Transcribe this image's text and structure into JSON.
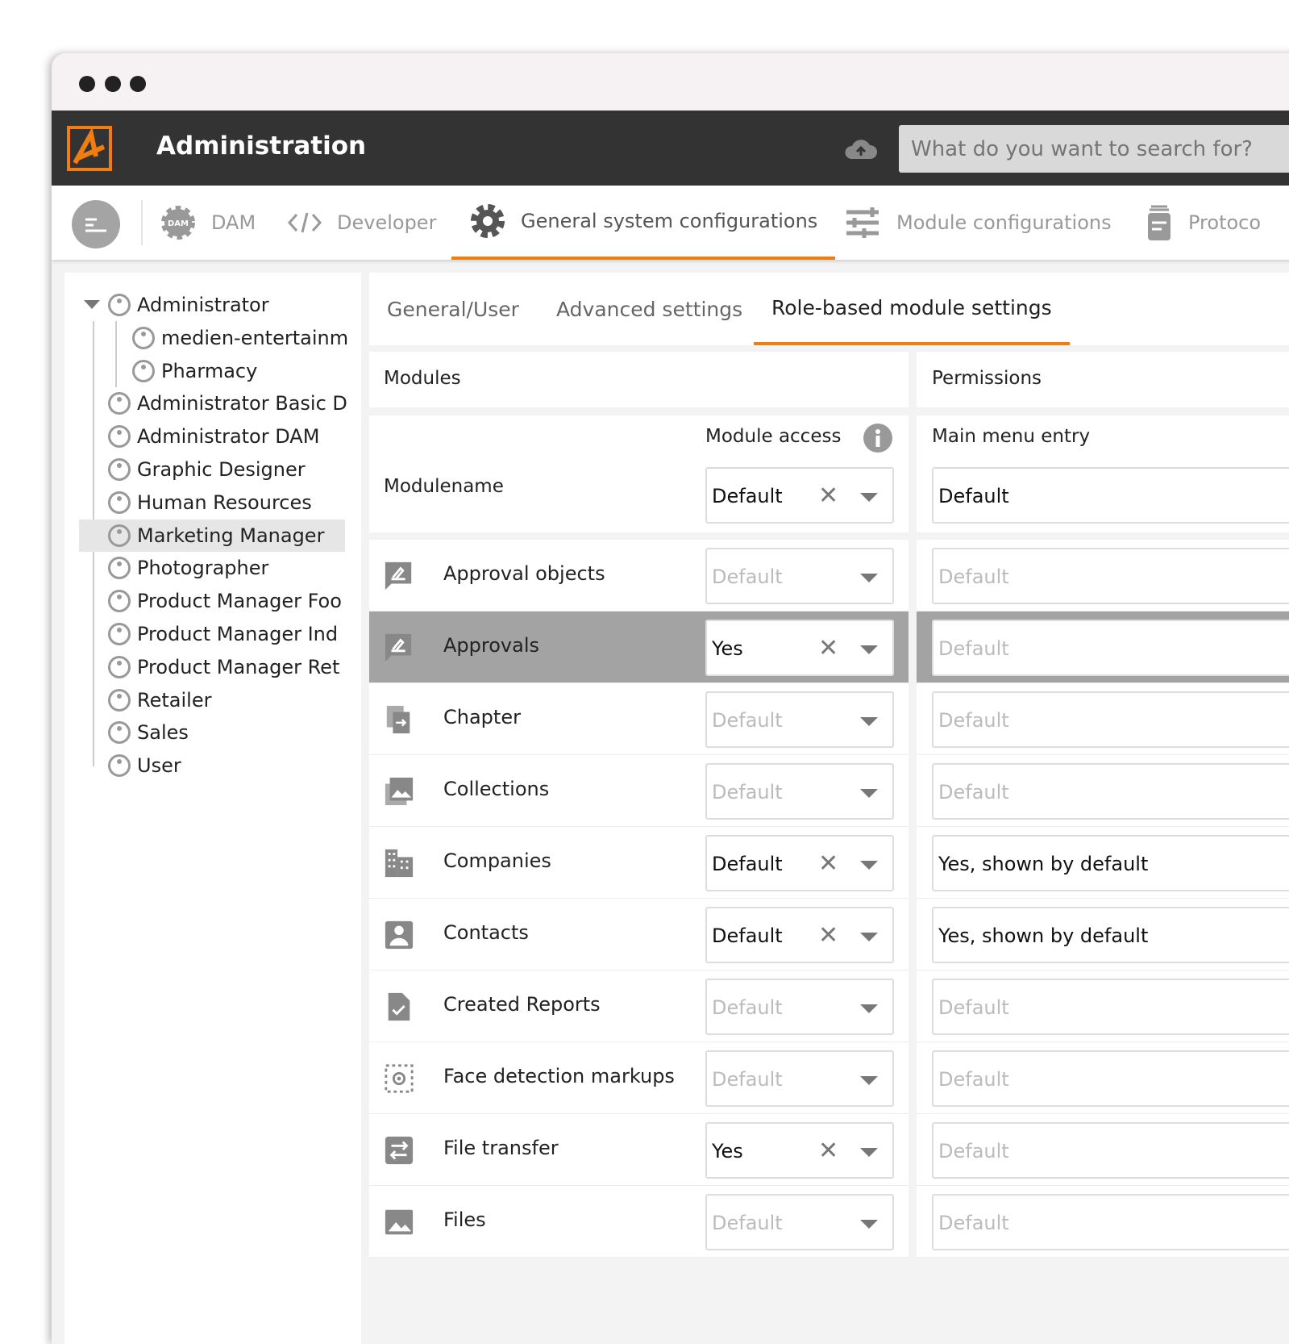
{
  "window": {
    "dots": 3
  },
  "header": {
    "title": "Administration",
    "search_placeholder": "What do you want to search for?"
  },
  "nav": {
    "tabs": [
      {
        "label": "DAM",
        "icon": "dam-gear-icon"
      },
      {
        "label": "Developer",
        "icon": "code-icon"
      },
      {
        "label": "General system configurations",
        "icon": "gear-icon",
        "active": true
      },
      {
        "label": "Module configurations",
        "icon": "sliders-icon"
      },
      {
        "label": "Protoco",
        "icon": "protocol-icon"
      }
    ]
  },
  "sidebar": {
    "roles": [
      {
        "label": "Administrator",
        "level": 0,
        "expanded": true
      },
      {
        "label": "medien-entertainm",
        "level": 1
      },
      {
        "label": "Pharmacy",
        "level": 1
      },
      {
        "label": "Administrator Basic D",
        "level": 0
      },
      {
        "label": "Administrator DAM",
        "level": 0
      },
      {
        "label": "Graphic Designer",
        "level": 0
      },
      {
        "label": "Human Resources",
        "level": 0
      },
      {
        "label": "Marketing Manager",
        "level": 0,
        "selected": true
      },
      {
        "label": "Photographer",
        "level": 0
      },
      {
        "label": "Product Manager Foo",
        "level": 0
      },
      {
        "label": "Product Manager Ind",
        "level": 0
      },
      {
        "label": "Product Manager Ret",
        "level": 0
      },
      {
        "label": "Retailer",
        "level": 0
      },
      {
        "label": "Sales",
        "level": 0
      },
      {
        "label": "User",
        "level": 0
      }
    ]
  },
  "subtabs": [
    {
      "label": "General/User"
    },
    {
      "label": "Advanced settings"
    },
    {
      "label": "Role-based module settings",
      "active": true
    }
  ],
  "table": {
    "modules_header": "Modules",
    "permissions_header": "Permissions",
    "module_access_label": "Module access",
    "main_menu_label": "Main menu entry",
    "modulename_label": "Modulename",
    "filter_access": "Default",
    "filter_menu": "Default",
    "rows": [
      {
        "name": "Approval objects",
        "icon": "approval-icon",
        "access": "Default",
        "access_set": false,
        "menu": "Default",
        "menu_set": false
      },
      {
        "name": "Approvals",
        "icon": "approval-icon",
        "access": "Yes",
        "access_set": true,
        "menu": "Default",
        "menu_set": false,
        "highlighted": true
      },
      {
        "name": "Chapter",
        "icon": "chapter-icon",
        "access": "Default",
        "access_set": false,
        "menu": "Default",
        "menu_set": false
      },
      {
        "name": "Collections",
        "icon": "collections-icon",
        "access": "Default",
        "access_set": false,
        "menu": "Default",
        "menu_set": false
      },
      {
        "name": "Companies",
        "icon": "companies-icon",
        "access": "Default",
        "access_set": true,
        "menu": "Yes, shown by default",
        "menu_set": true
      },
      {
        "name": "Contacts",
        "icon": "contact-icon",
        "access": "Default",
        "access_set": true,
        "menu": "Yes, shown by default",
        "menu_set": true
      },
      {
        "name": "Created Reports",
        "icon": "report-icon",
        "access": "Default",
        "access_set": false,
        "menu": "Default",
        "menu_set": false
      },
      {
        "name": "Face detection markups",
        "icon": "face-detection-icon",
        "access": "Default",
        "access_set": false,
        "menu": "Default",
        "menu_set": false
      },
      {
        "name": "File transfer",
        "icon": "file-transfer-icon",
        "access": "Yes",
        "access_set": true,
        "menu": "Default",
        "menu_set": false
      },
      {
        "name": "Files",
        "icon": "image-icon",
        "access": "Default",
        "access_set": false,
        "menu": "Default",
        "menu_set": false
      }
    ]
  },
  "colors": {
    "accent": "#f07d0f",
    "header": "#333333",
    "highlight": "#a3a3a3"
  }
}
